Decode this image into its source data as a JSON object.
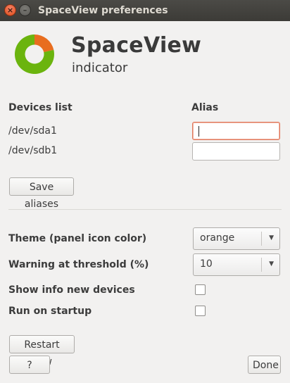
{
  "window": {
    "title": "SpaceView preferences",
    "close_glyph": "×",
    "minimize_glyph": "–"
  },
  "header": {
    "app_name": "SpaceView",
    "subtitle": "indicator"
  },
  "logo": {
    "icon": "pie-ring-icon",
    "colors": {
      "primary": "#6bb40e",
      "accent": "#e86d1f"
    }
  },
  "devices": {
    "column_devices": "Devices list",
    "column_alias": "Alias",
    "rows": [
      {
        "device": "/dev/sda1",
        "alias": ""
      },
      {
        "device": "/dev/sdb1",
        "alias": ""
      }
    ],
    "save_label": "Save aliases"
  },
  "settings": {
    "theme_label": "Theme (panel icon color)",
    "theme_value": "orange",
    "threshold_label": "Warning at threshold (%)",
    "threshold_value": "10",
    "show_info_label": "Show info new devices",
    "show_info_checked": false,
    "startup_label": "Run on startup",
    "startup_checked": false
  },
  "footer": {
    "restart_label": "Restart now",
    "help_label": "?",
    "done_label": "Done"
  }
}
